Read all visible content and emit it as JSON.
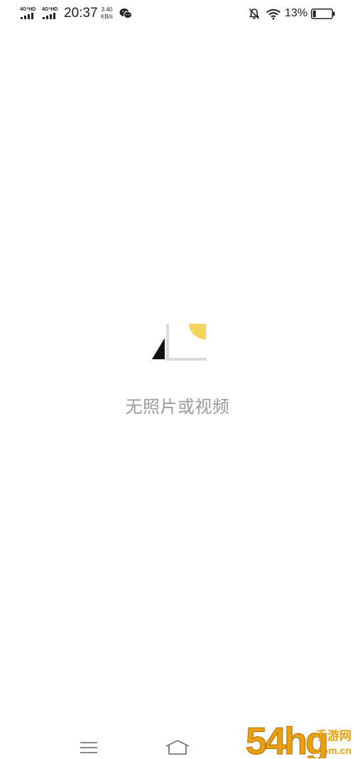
{
  "status_bar": {
    "signal_1": "4G⁺HD",
    "signal_2": "4G⁺HD",
    "time": "20:37",
    "speed_value": "3.40",
    "speed_unit": "KB/s",
    "battery_percent": "13%",
    "icons": [
      "signal-icon",
      "signal-icon",
      "wechat-icon",
      "mute-icon",
      "wifi-icon",
      "battery-icon"
    ]
  },
  "empty_state": {
    "message": "无照片或视频",
    "illustration_colors": {
      "accent": "#f2d35c",
      "dark": "#111111",
      "frame": "#dcdcdc"
    }
  },
  "nav_bar": {
    "icons": [
      "menu-icon",
      "home-icon"
    ]
  },
  "watermark": {
    "brand": "54hg",
    "site": "手游网",
    "domain": ".com.cn",
    "color": "#e8a010"
  }
}
